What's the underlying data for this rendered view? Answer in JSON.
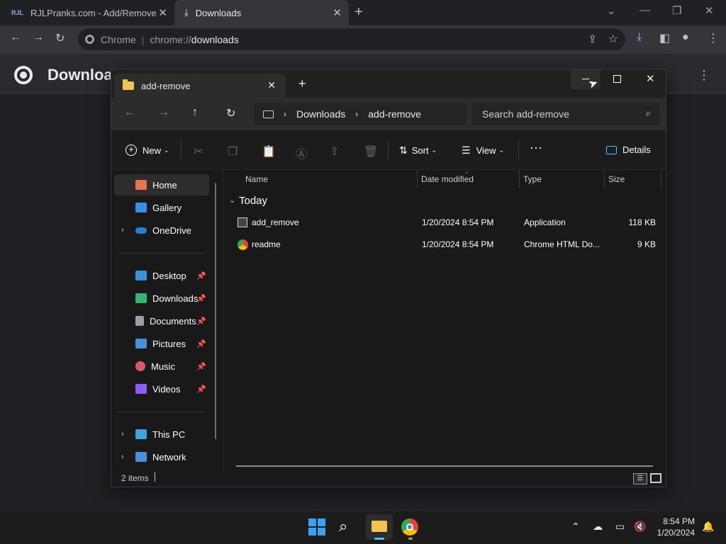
{
  "browser": {
    "tabs": [
      {
        "label": "RJLPranks.com - Add/Remove",
        "favicon": "rjl-favicon"
      },
      {
        "label": "Downloads",
        "favicon": "download-icon"
      }
    ],
    "omnibox": {
      "chip": "Chrome",
      "url_prefix": "chrome://",
      "url_path": "downloads"
    },
    "page_title": "Downloa"
  },
  "explorer": {
    "tab_label": "add-remove",
    "breadcrumb": [
      "Downloads",
      "add-remove"
    ],
    "search_placeholder": "Search add-remove",
    "commands": {
      "new": "New",
      "sort": "Sort",
      "view": "View",
      "details": "Details"
    },
    "nav": {
      "top": [
        {
          "label": "Home",
          "icon": "home-icon",
          "color": "#e8734f"
        },
        {
          "label": "Gallery",
          "icon": "gallery-icon",
          "color": "#3a8ee6"
        },
        {
          "label": "OneDrive",
          "icon": "cloud-icon",
          "color": "#2a7fd4"
        }
      ],
      "quick": [
        {
          "label": "Desktop",
          "icon": "desktop-icon",
          "color": "#3d8fd9"
        },
        {
          "label": "Downloads",
          "icon": "download-icon",
          "color": "#34b371"
        },
        {
          "label": "Documents",
          "icon": "documents-icon",
          "color": "#9aa0a6"
        },
        {
          "label": "Pictures",
          "icon": "pictures-icon",
          "color": "#4a90d9"
        },
        {
          "label": "Music",
          "icon": "music-icon",
          "color": "#d9586f"
        },
        {
          "label": "Videos",
          "icon": "videos-icon",
          "color": "#8b5cf6"
        }
      ],
      "bottom": [
        {
          "label": "This PC",
          "icon": "pc-icon",
          "color": "#3da4e0"
        },
        {
          "label": "Network",
          "icon": "network-icon",
          "color": "#4a90d9"
        }
      ]
    },
    "columns": [
      "Name",
      "Date modified",
      "Type",
      "Size"
    ],
    "group": "Today",
    "files": [
      {
        "name": "add_remove",
        "date": "1/20/2024 8:54 PM",
        "type": "Application",
        "size": "118 KB",
        "icon": "application-icon"
      },
      {
        "name": "readme",
        "date": "1/20/2024 8:54 PM",
        "type": "Chrome HTML Do...",
        "size": "9 KB",
        "icon": "chrome-html-icon"
      }
    ],
    "status": "2 items"
  },
  "taskbar": {
    "time": "8:54 PM",
    "date": "1/20/2024"
  }
}
